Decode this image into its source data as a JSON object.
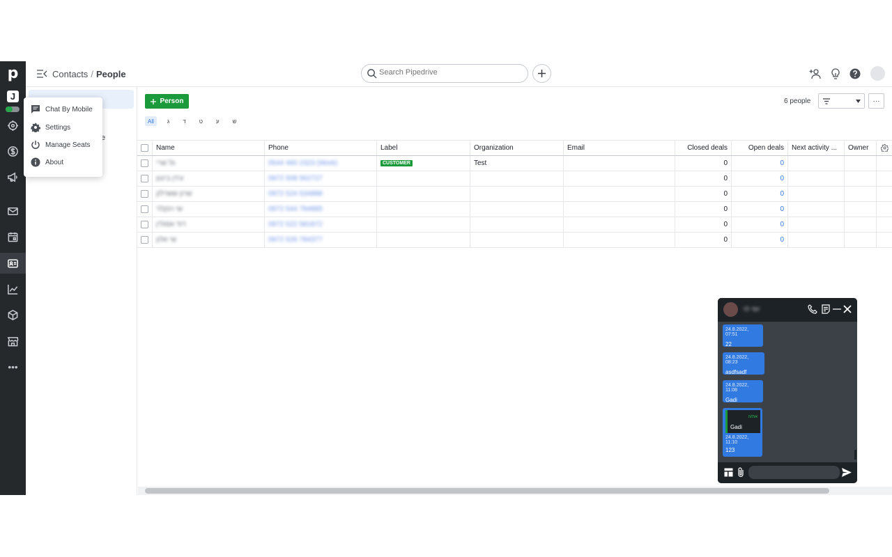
{
  "breadcrumb": {
    "parent": "Contacts",
    "separator": "/",
    "current": "People"
  },
  "search": {
    "placeholder": "Search Pipedrive"
  },
  "rail": {
    "logo": "p",
    "app_letter": "J"
  },
  "subnav": {
    "item2_fragment": "e"
  },
  "menu": {
    "items": [
      {
        "label": "Chat By Mobile",
        "icon": "chat-icon"
      },
      {
        "label": "Settings",
        "icon": "gear-icon"
      },
      {
        "label": "Manage Seats",
        "icon": "power-icon"
      },
      {
        "label": "About",
        "icon": "info-icon"
      }
    ]
  },
  "toolbar": {
    "add_person_label": "Person",
    "people_count": "6 people",
    "more_label": "···"
  },
  "filters": {
    "letters": [
      "All",
      "ג",
      "ד",
      "ט",
      "ע",
      "ש"
    ],
    "active": "All"
  },
  "table": {
    "columns": [
      "Name",
      "Phone",
      "Label",
      "Organization",
      "Email",
      "Closed deals",
      "Open deals",
      "Next activity ...",
      "Owner"
    ],
    "rows": [
      {
        "name": "גל שרי",
        "phone": "0544 460 2323 (Work)",
        "label": "CUSTOMER",
        "organization": "Test",
        "closed_deals": "0",
        "open_deals": "0"
      },
      {
        "name": "עידן ביטון",
        "phone": "0972 508 562727",
        "label": "",
        "organization": "",
        "closed_deals": "0",
        "open_deals": "0"
      },
      {
        "name": "שרון ששרלק",
        "phone": "0972 524 534888",
        "label": "",
        "organization": "",
        "closed_deals": "0",
        "open_deals": "0"
      },
      {
        "name": "שי וינקלר",
        "phone": "0972 544 784885",
        "label": "",
        "organization": "",
        "closed_deals": "0",
        "open_deals": "0"
      },
      {
        "name": "דוד אסולין",
        "phone": "0972 522 581872",
        "label": "",
        "organization": "",
        "closed_deals": "0",
        "open_deals": "0"
      },
      {
        "name": "שי אלון",
        "phone": "0972 526 784377",
        "label": "",
        "organization": "",
        "closed_deals": "0",
        "open_deals": "0"
      }
    ]
  },
  "chat": {
    "contact_name": "יוסי לוי",
    "messages": [
      {
        "time": "24.8.2022, 07:51",
        "text": "22"
      },
      {
        "time": "24.8.2022, 08:23",
        "text": "asdfsadf"
      },
      {
        "time": "24.8.2022, 11:08",
        "text": "Gadi"
      },
      {
        "time": "24.8.2022, 11:10",
        "text": "123",
        "quote": {
          "header": "את/ה",
          "body": "Gadi"
        }
      }
    ]
  },
  "colors": {
    "rail": "#26292c",
    "accent_green": "#1b9a3c",
    "link_blue": "#317ae2",
    "chat_bg": "#3b4147"
  }
}
